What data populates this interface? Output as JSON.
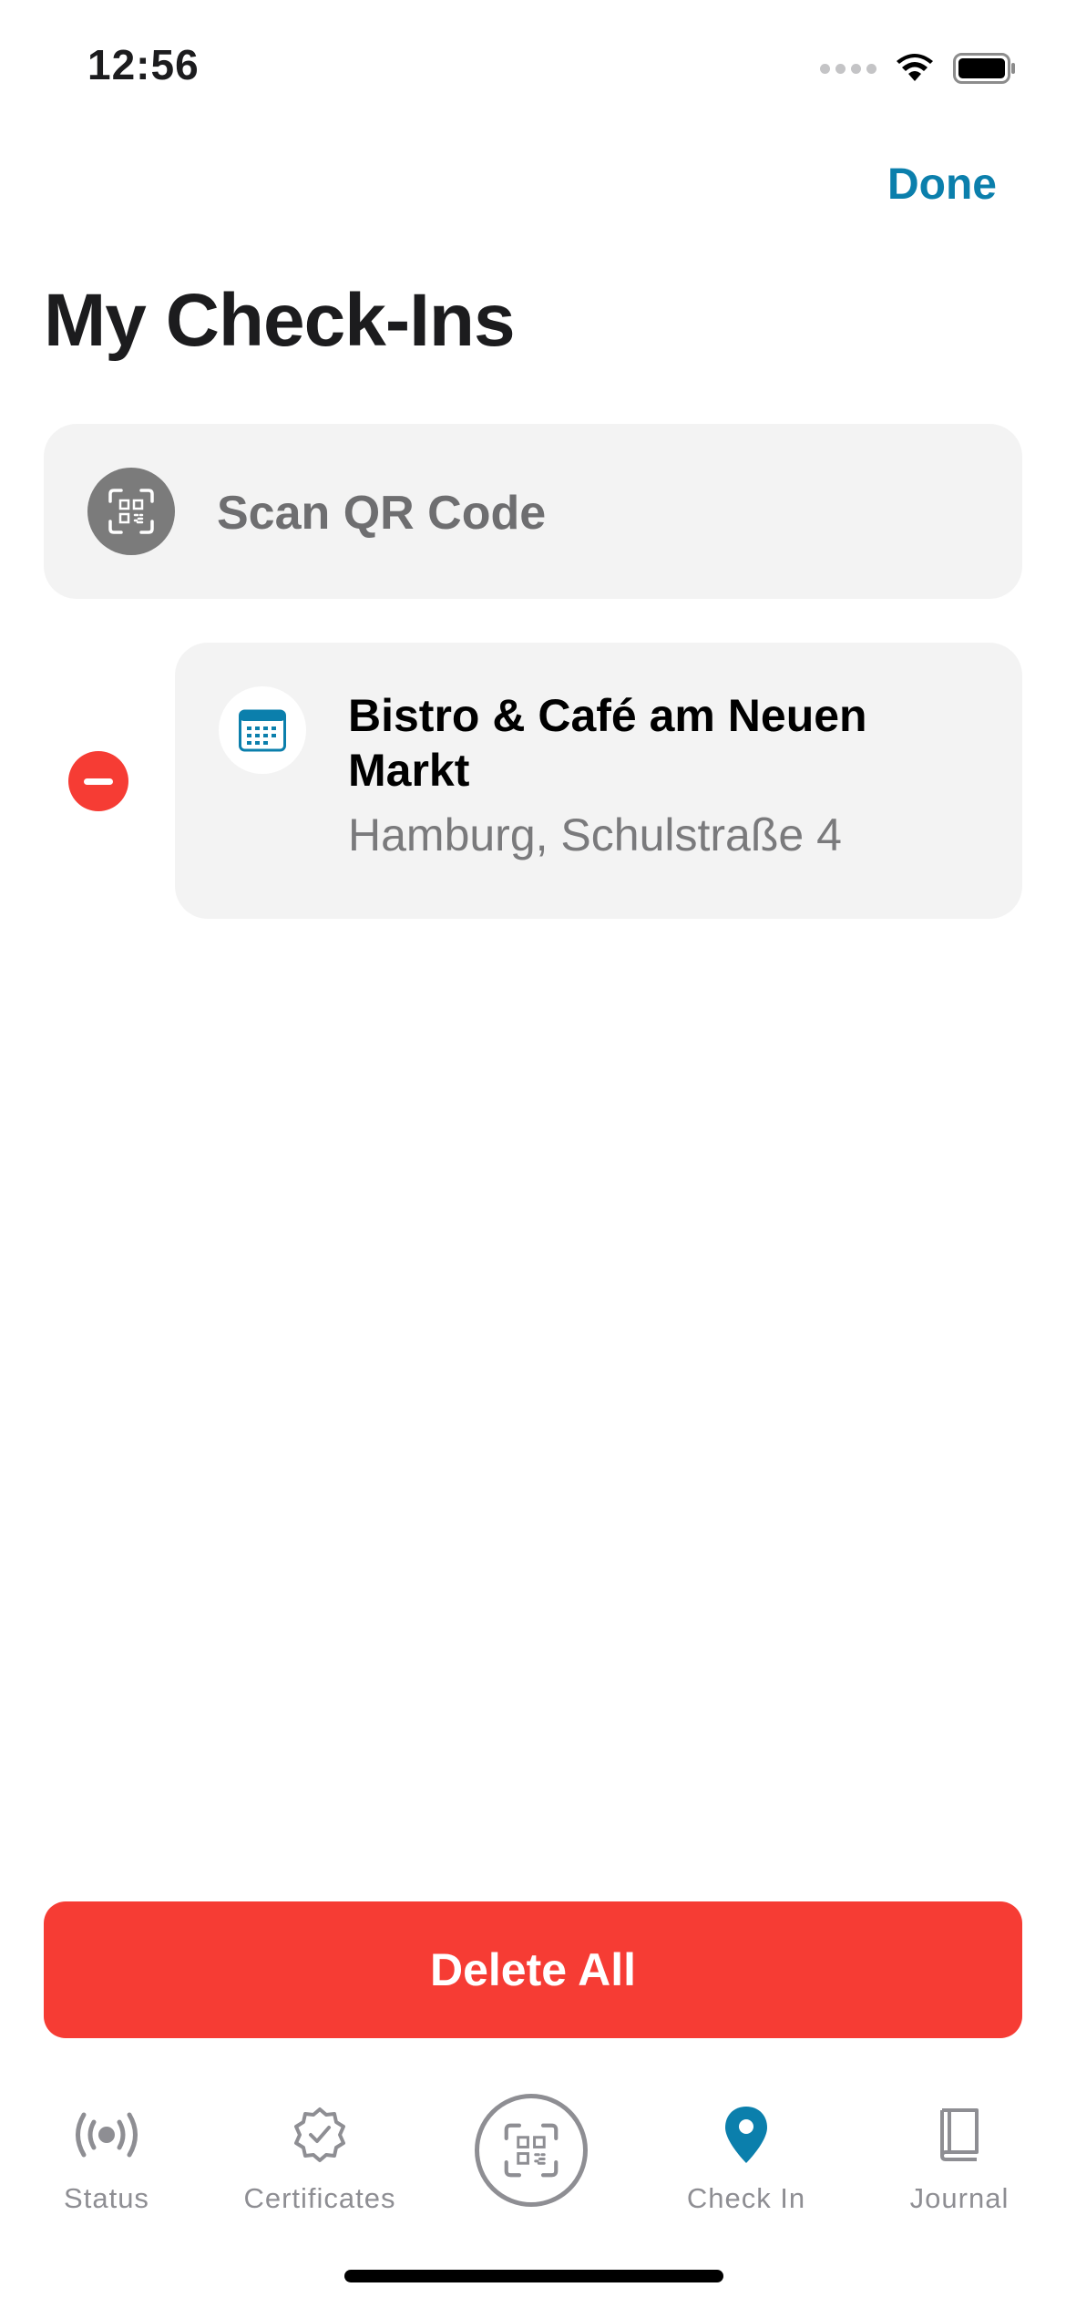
{
  "status_bar": {
    "time": "12:56"
  },
  "nav": {
    "done_label": "Done"
  },
  "page": {
    "title": "My Check-Ins"
  },
  "scan": {
    "label": "Scan QR Code"
  },
  "checkins": [
    {
      "name": "Bistro & Café am Neuen Markt",
      "address": "Hamburg, Schulstraße 4"
    }
  ],
  "actions": {
    "delete_all_label": "Delete All"
  },
  "tabbar": {
    "tabs": [
      {
        "label": "Status",
        "icon": "broadcast-icon"
      },
      {
        "label": "Certificates",
        "icon": "verified-badge-icon"
      },
      {
        "label": "",
        "icon": "qr-scan-icon"
      },
      {
        "label": "Check In",
        "icon": "location-pin-icon",
        "active": true
      },
      {
        "label": "Journal",
        "icon": "book-icon"
      }
    ]
  },
  "colors": {
    "accent": "#0b7fac",
    "destructive": "#f63c34",
    "card": "#f3f3f3",
    "inactive": "#8e8e93"
  }
}
